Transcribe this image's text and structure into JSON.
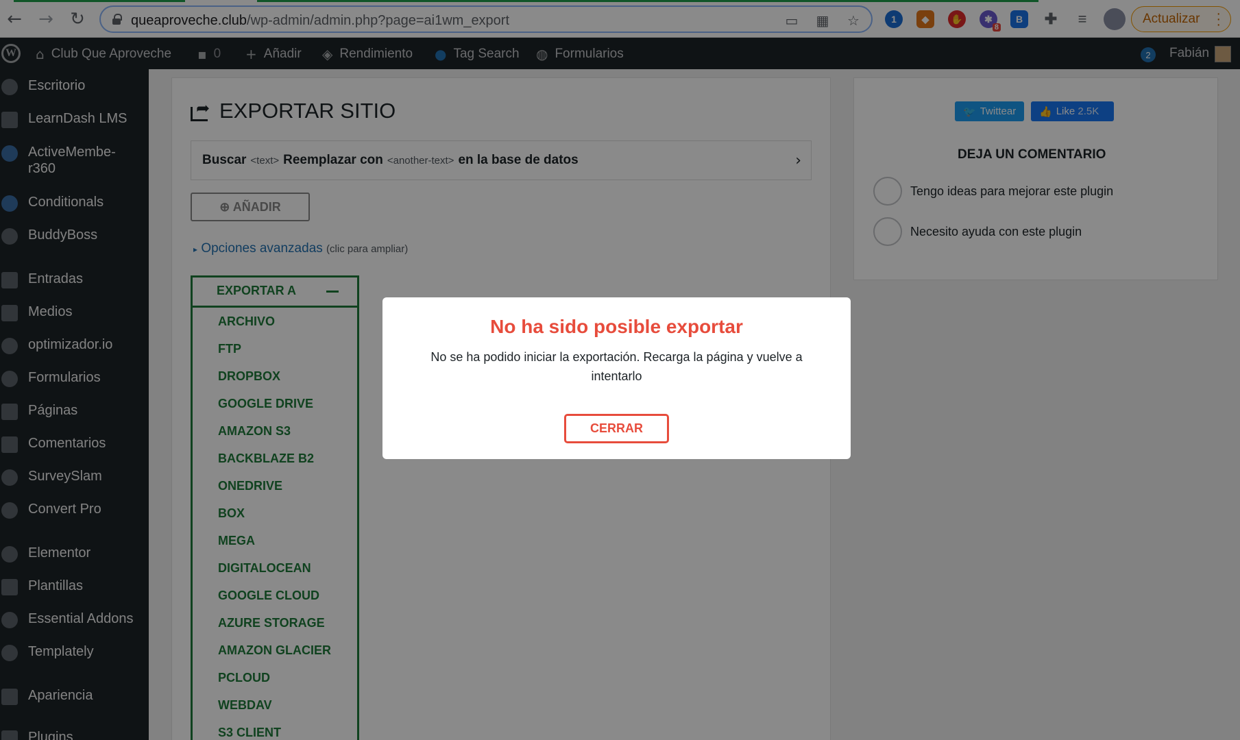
{
  "browser": {
    "url_host": "queaproveche.club",
    "url_path": "/wp-admin/admin.php?page=ai1wm_export",
    "update_label": "Actualizar",
    "ext_badge": "8",
    "back_icon": "arrow-left-icon",
    "forward_icon": "arrow-right-icon",
    "reload_icon": "reload-icon"
  },
  "adminbar": {
    "site_name": "Club Que Aproveche",
    "comments_count": "0",
    "add_label": "Añadir",
    "performance_label": "Rendimiento",
    "tag_search_label": "Tag Search",
    "forms_label": "Formularios",
    "notif_count": "2",
    "user_name": "Fabián"
  },
  "sidebar": {
    "items": [
      {
        "label": "Escritorio"
      },
      {
        "label": "LearnDash LMS"
      },
      {
        "label": "ActiveMembe-\nr360"
      },
      {
        "label": "Conditionals"
      },
      {
        "label": "BuddyBoss"
      },
      {
        "label": "Entradas"
      },
      {
        "label": "Medios"
      },
      {
        "label": "optimizador.io"
      },
      {
        "label": "Formularios"
      },
      {
        "label": "Páginas"
      },
      {
        "label": "Comentarios"
      },
      {
        "label": "SurveySlam"
      },
      {
        "label": "Convert Pro"
      },
      {
        "label": "Elementor"
      },
      {
        "label": "Plantillas"
      },
      {
        "label": "Essential Addons"
      },
      {
        "label": "Templately"
      },
      {
        "label": "Apariencia"
      },
      {
        "label": "Plugins"
      }
    ]
  },
  "main": {
    "title": "EXPORTAR SITIO",
    "search_bar": {
      "word1": "Buscar",
      "tag1": "<text>",
      "word2": "Reemplazar con",
      "tag2": "<another-text>",
      "word3": "en la base de datos"
    },
    "add_button": "⊕ AÑADIR",
    "advanced_link": "Opciones avanzadas",
    "advanced_hint": "(clic para ampliar)",
    "export_to": "EXPORTAR A",
    "export_options": [
      "ARCHIVO",
      "FTP",
      "DROPBOX",
      "GOOGLE DRIVE",
      "AMAZON S3",
      "BACKBLAZE B2",
      "ONEDRIVE",
      "BOX",
      "MEGA",
      "DIGITALOCEAN",
      "GOOGLE CLOUD",
      "AZURE STORAGE",
      "AMAZON GLACIER",
      "PCLOUD",
      "WEBDAV",
      "S3 CLIENT"
    ]
  },
  "side": {
    "twitter": "Twittear",
    "like": "Like",
    "like_count": "2.5K",
    "comment_title": "DEJA UN COMENTARIO",
    "option1": "Tengo ideas para mejorar este plugin",
    "option2": "Necesito ayuda con este plugin"
  },
  "modal": {
    "title": "No ha sido posible exportar",
    "message": "No se ha podido iniciar la exportación. Recarga la página y vuelve a intentarlo",
    "close_button": "CERRAR"
  },
  "colors": {
    "error_red": "#e74c3c",
    "export_green": "#1e7a3a",
    "wp_dark": "#1d2327",
    "link_blue": "#2271b1"
  }
}
